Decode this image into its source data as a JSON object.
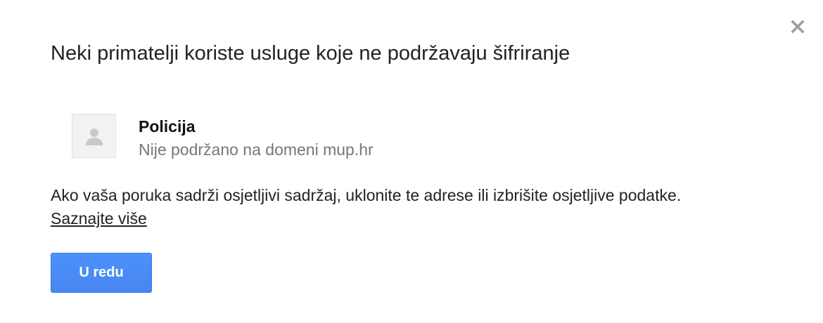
{
  "dialog": {
    "title": "Neki primatelji koriste usluge koje ne podržavaju šifriranje",
    "close_icon": "close-icon",
    "recipient": {
      "name": "Policija",
      "status": "Nije podržano na domeni mup.hr",
      "avatar_icon": "person-icon"
    },
    "message": "Ako vaša poruka sadrži osjetljivi sadržaj, uklonite te adrese ili izbrišite osjetljive podatke.",
    "learn_more_label": "Saznajte više",
    "ok_button_label": "U redu"
  },
  "colors": {
    "primary_button": "#4d90fe",
    "secondary_text": "#777777",
    "text": "#222222"
  }
}
